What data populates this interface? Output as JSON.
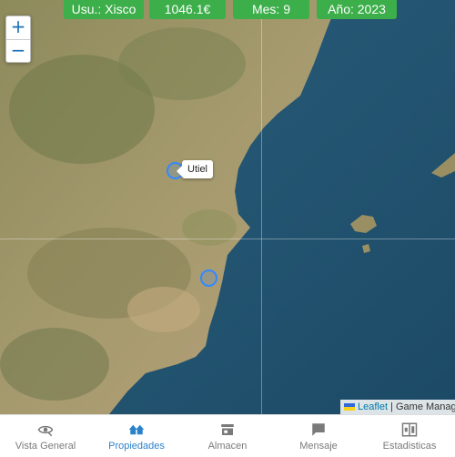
{
  "stats": {
    "user": "Usu.: Xisco",
    "money": "1046.1€",
    "month": "Mes: 9",
    "year": "Año: 2023"
  },
  "zoom": {
    "in_label": "+",
    "out_label": "−"
  },
  "map": {
    "tooltip": "Utiel",
    "attribution_link": "Leaflet",
    "attribution_text": " | Game Manage",
    "flag_colors": [
      "#2f6bd8",
      "#f7d21e"
    ]
  },
  "nav": {
    "items": [
      {
        "label": "Vista General",
        "icon": "eye-icon",
        "active": false
      },
      {
        "label": "Propiedades",
        "icon": "houses-icon",
        "active": true
      },
      {
        "label": "Almacen",
        "icon": "store-icon",
        "active": false
      },
      {
        "label": "Mensaje",
        "icon": "message-icon",
        "active": false
      },
      {
        "label": "Estadisticas",
        "icon": "stats-icon",
        "active": false
      }
    ]
  },
  "colors": {
    "accent_green": "#3cae4a",
    "nav_active": "#2c82c9",
    "nav_inactive": "#7a7a7a",
    "marker": "#3388ff"
  }
}
